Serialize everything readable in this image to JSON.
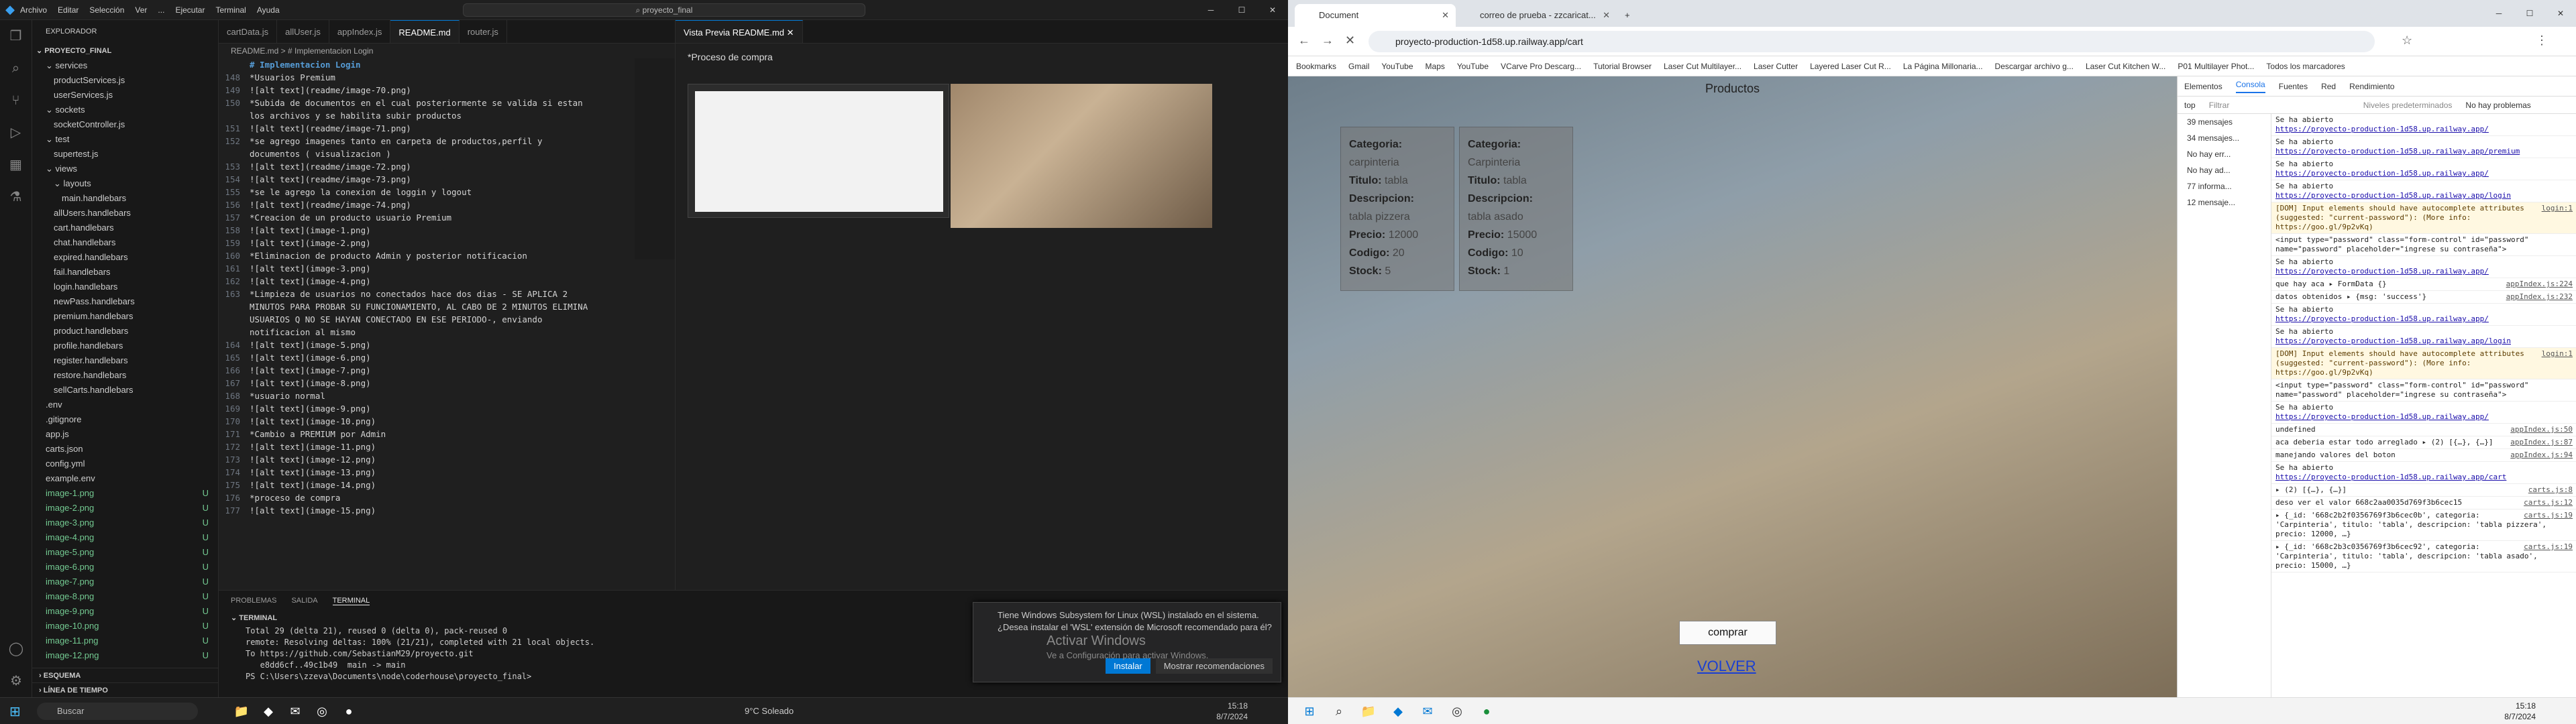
{
  "vscode": {
    "menu": [
      "Archivo",
      "Editar",
      "Selección",
      "Ver",
      "...",
      "Ejecutar",
      "Terminal",
      "Ayuda"
    ],
    "command_center": "proyecto_final",
    "explorer_title": "EXPLORADOR",
    "project": "PROYECTO_FINAL",
    "tree": [
      {
        "label": "services",
        "indent": 1,
        "type": "folder"
      },
      {
        "label": "productServices.js",
        "indent": 2,
        "type": "file"
      },
      {
        "label": "userServices.js",
        "indent": 2,
        "type": "file"
      },
      {
        "label": "sockets",
        "indent": 1,
        "type": "folder"
      },
      {
        "label": "socketController.js",
        "indent": 2,
        "type": "file"
      },
      {
        "label": "test",
        "indent": 1,
        "type": "folder"
      },
      {
        "label": "supertest.js",
        "indent": 2,
        "type": "file"
      },
      {
        "label": "views",
        "indent": 1,
        "type": "folder"
      },
      {
        "label": "layouts",
        "indent": 2,
        "type": "folder"
      },
      {
        "label": "main.handlebars",
        "indent": 3,
        "type": "file"
      },
      {
        "label": "allUsers.handlebars",
        "indent": 2,
        "type": "file"
      },
      {
        "label": "cart.handlebars",
        "indent": 2,
        "type": "file"
      },
      {
        "label": "chat.handlebars",
        "indent": 2,
        "type": "file"
      },
      {
        "label": "expired.handlebars",
        "indent": 2,
        "type": "file"
      },
      {
        "label": "fail.handlebars",
        "indent": 2,
        "type": "file"
      },
      {
        "label": "login.handlebars",
        "indent": 2,
        "type": "file"
      },
      {
        "label": "newPass.handlebars",
        "indent": 2,
        "type": "file"
      },
      {
        "label": "premium.handlebars",
        "indent": 2,
        "type": "file"
      },
      {
        "label": "product.handlebars",
        "indent": 2,
        "type": "file"
      },
      {
        "label": "profile.handlebars",
        "indent": 2,
        "type": "file"
      },
      {
        "label": "register.handlebars",
        "indent": 2,
        "type": "file"
      },
      {
        "label": "restore.handlebars",
        "indent": 2,
        "type": "file"
      },
      {
        "label": "sellCarts.handlebars",
        "indent": 2,
        "type": "file"
      },
      {
        "label": ".env",
        "indent": 1,
        "type": "file"
      },
      {
        "label": ".gitignore",
        "indent": 1,
        "type": "file"
      },
      {
        "label": "app.js",
        "indent": 1,
        "type": "file"
      },
      {
        "label": "carts.json",
        "indent": 1,
        "type": "file"
      },
      {
        "label": "config.yml",
        "indent": 1,
        "type": "file"
      },
      {
        "label": "example.env",
        "indent": 1,
        "type": "file"
      },
      {
        "label": "image-1.png",
        "indent": 1,
        "type": "new",
        "badge": "U"
      },
      {
        "label": "image-2.png",
        "indent": 1,
        "type": "new",
        "badge": "U"
      },
      {
        "label": "image-3.png",
        "indent": 1,
        "type": "new",
        "badge": "U"
      },
      {
        "label": "image-4.png",
        "indent": 1,
        "type": "new",
        "badge": "U"
      },
      {
        "label": "image-5.png",
        "indent": 1,
        "type": "new",
        "badge": "U"
      },
      {
        "label": "image-6.png",
        "indent": 1,
        "type": "new",
        "badge": "U"
      },
      {
        "label": "image-7.png",
        "indent": 1,
        "type": "new",
        "badge": "U"
      },
      {
        "label": "image-8.png",
        "indent": 1,
        "type": "new",
        "badge": "U"
      },
      {
        "label": "image-9.png",
        "indent": 1,
        "type": "new",
        "badge": "U"
      },
      {
        "label": "image-10.png",
        "indent": 1,
        "type": "new",
        "badge": "U"
      },
      {
        "label": "image-11.png",
        "indent": 1,
        "type": "new",
        "badge": "U"
      },
      {
        "label": "image-12.png",
        "indent": 1,
        "type": "new",
        "badge": "U"
      }
    ],
    "outline": "ESQUEMA",
    "timeline": "LÍNEA DE TIEMPO",
    "tabs": [
      "cartData.js",
      "allUser.js",
      "appIndex.js",
      "README.md",
      "router.js"
    ],
    "active_tab": "README.md",
    "breadcrumb": "README.md > # Implementacion Login",
    "code": [
      {
        "n": "",
        "t": "# Implementacion Login",
        "head": true
      },
      {
        "n": "148",
        "t": "*Usuarios Premium"
      },
      {
        "n": "149",
        "t": "![alt text](readme/image-70.png)"
      },
      {
        "n": "150",
        "t": "*Subida de documentos en el cual posteriormente se valida si estan"
      },
      {
        "n": "",
        "t": "los archivos y se habilita subir productos"
      },
      {
        "n": "151",
        "t": "![alt text](readme/image-71.png)"
      },
      {
        "n": "152",
        "t": "*se agrego imagenes tanto en carpeta de productos,perfil y"
      },
      {
        "n": "",
        "t": "documentos ( visualizacion )"
      },
      {
        "n": "153",
        "t": "![alt text](readme/image-72.png)"
      },
      {
        "n": "154",
        "t": "![alt text](readme/image-73.png)"
      },
      {
        "n": "155",
        "t": "*se le agrego la conexion de loggin y logout"
      },
      {
        "n": "156",
        "t": "![alt text](readme/image-74.png)"
      },
      {
        "n": "157",
        "t": "*Creacion de un producto usuario Premium"
      },
      {
        "n": "158",
        "t": "![alt text](image-1.png)"
      },
      {
        "n": "159",
        "t": "![alt text](image-2.png)"
      },
      {
        "n": "160",
        "t": "*Eliminacion de producto Admin y posterior notificacion"
      },
      {
        "n": "161",
        "t": "![alt text](image-3.png)"
      },
      {
        "n": "162",
        "t": "![alt text](image-4.png)"
      },
      {
        "n": "163",
        "t": "*Limpieza de usuarios no conectados hace dos dias - SE APLICA 2"
      },
      {
        "n": "",
        "t": "MINUTOS PARA PROBAR SU FUNCIONAMIENTO, AL CABO DE 2 MINUTOS ELIMINA"
      },
      {
        "n": "",
        "t": "USUARIOS Q NO SE HAYAN CONECTADO EN ESE PERIODO-, enviando"
      },
      {
        "n": "",
        "t": "notificacion al mismo"
      },
      {
        "n": "164",
        "t": "![alt text](image-5.png)"
      },
      {
        "n": "165",
        "t": "![alt text](image-6.png)"
      },
      {
        "n": "166",
        "t": "![alt text](image-7.png)"
      },
      {
        "n": "167",
        "t": "![alt text](image-8.png)"
      },
      {
        "n": "168",
        "t": "*usuario normal"
      },
      {
        "n": "169",
        "t": "![alt text](image-9.png)"
      },
      {
        "n": "170",
        "t": "![alt text](image-10.png)"
      },
      {
        "n": "171",
        "t": "*Cambio a PREMIUM por Admin"
      },
      {
        "n": "172",
        "t": "![alt text](image-11.png)"
      },
      {
        "n": "173",
        "t": "![alt text](image-12.png)"
      },
      {
        "n": "174",
        "t": "![alt text](image-13.png)"
      },
      {
        "n": "175",
        "t": "![alt text](image-14.png)"
      },
      {
        "n": "176",
        "t": "*proceso de compra"
      },
      {
        "n": "177",
        "t": "![alt text](image-15.png)"
      }
    ],
    "preview_tab": "Vista Previa README.md",
    "preview_text": "*Proceso de compra",
    "panel_tabs": [
      "PROBLEMAS",
      "SALIDA",
      "TERMINAL"
    ],
    "terminal_title": "TERMINAL",
    "terminal": [
      "Total 29 (delta 21), reused 0 (delta 0), pack-reused 0",
      "remote: Resolving deltas: 100% (21/21), completed with 21 local objects.",
      "To https://github.com/SebastianM29/proyecto.git",
      "   e8dd6cf..49c1b49  main -> main",
      "PS C:\\Users\\zzeva\\Documents\\node\\coderhouse\\proyecto_final> "
    ],
    "notification": {
      "text": "Tiene Windows Subsystem for Linux (WSL) instalado en el sistema. ¿Desea instalar el 'WSL' extensión de Microsoft recomendado para él?",
      "install": "Instalar",
      "show": "Mostrar recomendaciones"
    },
    "watermark": "Activar Windows",
    "watermark_sub": "Ve a Configuración para activar Windows."
  },
  "taskbar": {
    "search": "Buscar",
    "weather": "9°C  Soleado",
    "time": "15:18",
    "date": "8/7/2024"
  },
  "chrome": {
    "tabs": [
      "Document",
      "correo de prueba - zzcaricat..."
    ],
    "url": "proyecto-production-1d58.up.railway.app/cart",
    "bookmarks": [
      "Bookmarks",
      "Gmail",
      "YouTube",
      "Maps",
      "YouTube",
      "VCarve Pro Descarg...",
      "Tutorial Browser",
      "Laser Cut Multilayer...",
      "Laser Cutter",
      "Layered Laser Cut R...",
      "La Página Millonaria...",
      "Descargar archivo g...",
      "Laser Cut Kitchen W...",
      "P01 Multilayer Phot...",
      "Todos los marcadores"
    ],
    "page_title": "Productos",
    "cards": [
      {
        "cat_label": "Categoria:",
        "cat": "carpinteria",
        "title_label": "Titulo:",
        "title": "tabla",
        "desc_label": "Descripcion:",
        "desc": "tabla pizzera",
        "price_label": "Precio:",
        "price": "12000",
        "code_label": "Codigo:",
        "code": "20",
        "stock_label": "Stock:",
        "stock": "5"
      },
      {
        "cat_label": "Categoria:",
        "cat": "Carpinteria",
        "title_label": "Titulo:",
        "title": "tabla",
        "desc_label": "Descripcion:",
        "desc": "tabla asado",
        "price_label": "Precio:",
        "price": "15000",
        "code_label": "Codigo:",
        "code": "10",
        "stock_label": "Stock:",
        "stock": "1"
      }
    ],
    "buy": "comprar",
    "back": "VOLVER"
  },
  "devtools": {
    "tabs": [
      "Elementos",
      "Consola",
      "Fuentes",
      "Red",
      "Rendimiento"
    ],
    "active": "Consola",
    "filter": "Filtrar",
    "levels": "Niveles predeterminados",
    "issues": "No hay problemas",
    "context": "top",
    "sidebar": [
      "39 mensajes",
      "34 mensajes...",
      "No hay err...",
      "No hay ad...",
      "77 informa...",
      "12 mensaje..."
    ],
    "console": [
      {
        "t": "Se ha abierto",
        "link": "https://proyecto-production-1d58.up.railway.app/",
        "src": ""
      },
      {
        "t": "Se ha abierto",
        "link": "https://proyecto-production-1d58.up.railway.app/premium",
        "src": ""
      },
      {
        "t": "Se ha abierto",
        "link": "https://proyecto-production-1d58.up.railway.app/",
        "src": ""
      },
      {
        "t": "Se ha abierto",
        "link": "https://proyecto-production-1d58.up.railway.app/login",
        "src": ""
      },
      {
        "t": "[DOM] Input elements should have autocomplete attributes (suggested: \"current-password\"): (More info: https://goo.gl/9p2vKq)",
        "link": "",
        "src": "login:1",
        "warn": true
      },
      {
        "t": "<input type=\"password\" class=\"form-control\" id=\"password\" name=\"password\" placeholder=\"ingrese su contraseña\">",
        "link": "",
        "src": ""
      },
      {
        "t": "Se ha abierto",
        "link": "https://proyecto-production-1d58.up.railway.app/",
        "src": ""
      },
      {
        "t": "que hay aca  ▸ FormData {}",
        "link": "",
        "src": "appIndex.js:224"
      },
      {
        "t": "datos obtenidos  ▸ {msg: 'success'}",
        "link": "",
        "src": "appIndex.js:232"
      },
      {
        "t": "Se ha abierto",
        "link": "https://proyecto-production-1d58.up.railway.app/",
        "src": ""
      },
      {
        "t": "Se ha abierto",
        "link": "https://proyecto-production-1d58.up.railway.app/login",
        "src": ""
      },
      {
        "t": "[DOM] Input elements should have autocomplete attributes (suggested: \"current-password\"): (More info: https://goo.gl/9p2vKq)",
        "link": "",
        "src": "login:1",
        "warn": true
      },
      {
        "t": "<input type=\"password\" class=\"form-control\" id=\"password\" name=\"password\" placeholder=\"ingrese su contraseña\">",
        "link": "",
        "src": ""
      },
      {
        "t": "Se ha abierto",
        "link": "https://proyecto-production-1d58.up.railway.app/",
        "src": ""
      },
      {
        "t": "undefined",
        "link": "",
        "src": "appIndex.js:50"
      },
      {
        "t": "aca deberia estar todo arreglado  ▸ (2) [{…}, {…}]",
        "link": "",
        "src": "appIndex.js:87"
      },
      {
        "t": "manejando valores del boton",
        "link": "",
        "src": "appIndex.js:94"
      },
      {
        "t": "Se ha abierto",
        "link": "https://proyecto-production-1d58.up.railway.app/cart",
        "src": ""
      },
      {
        "t": "▸ (2) [{…}, {…}]",
        "link": "",
        "src": "carts.js:8"
      },
      {
        "t": "deso ver el valor 668c2aa0035d769f3b6cec15",
        "link": "",
        "src": "carts.js:12"
      },
      {
        "t": "▸ {_id: '668c2b2f0356769f3b6cec0b', categoria: 'Carpinteria', titulo: 'tabla', descripcion: 'tabla pizzera', precio: 12000, …}",
        "link": "",
        "src": "carts.js:19"
      },
      {
        "t": "▸ {_id: '668c2b3c0356769f3b6cec92', categoria: 'Carpinteria', titulo: 'tabla', descripcion: 'tabla asado', precio: 15000, …}",
        "link": "",
        "src": "carts.js:19"
      }
    ]
  }
}
